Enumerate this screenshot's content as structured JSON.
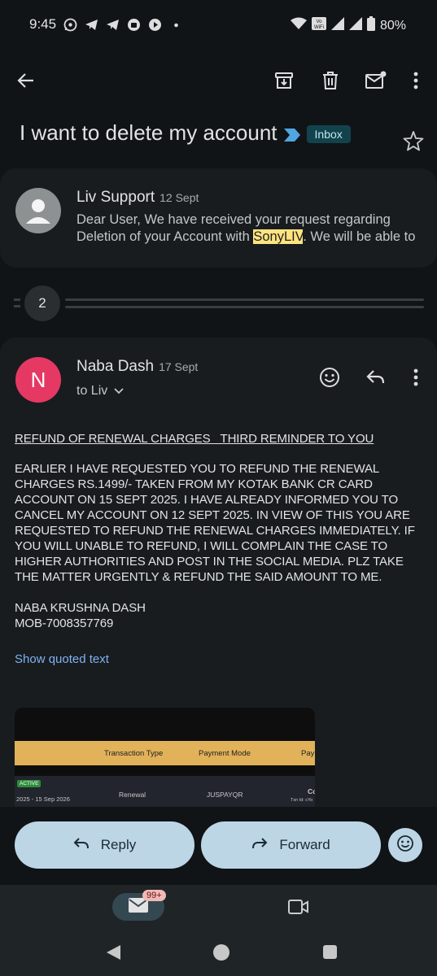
{
  "status_bar": {
    "time": "9:45",
    "battery": "80%",
    "wifi_label": "Vo WiFi"
  },
  "toolbar": {
    "icons": [
      "back-arrow-icon",
      "archive-icon",
      "delete-icon",
      "mark-unread-icon",
      "more-vert-icon"
    ]
  },
  "subject": {
    "title": "I want to delete my account",
    "label": "Inbox"
  },
  "message1": {
    "sender": "Liv Support",
    "date": "12 Sept",
    "snippet_line1": "Dear User, We have received your request regarding",
    "snippet_before": "Deletion of your Account with ",
    "snippet_highlight": "SonyLIV",
    "snippet_after": ". We will be able to"
  },
  "collapsed": {
    "count": "2"
  },
  "message2": {
    "avatar_letter": "N",
    "sender": "Naba Dash",
    "date": "17 Sept",
    "to": "to Liv",
    "heading": "REFUND OF RENEWAL CHARGES   THIRD REMINDER TO YOU",
    "paragraph": "EARLIER I HAVE REQUESTED YOU TO REFUND THE RENEWAL CHARGES RS.1499/- TAKEN FROM MY KOTAK BANK CR CARD ACCOUNT ON 15 SEPT 2025. I HAVE ALREADY INFORMED YOU TO CANCEL MY ACCOUNT ON 12 SEPT 2025. IN VIEW OF THIS YOU ARE REQUESTED TO REFUND THE RENEWAL CHARGES IMMEDIATELY. IF YOU WILL UNABLE TO  REFUND, I WILL COMPLAIN THE CASE TO HIGHER AUTHORITIES AND POST IN THE SOCIAL MEDIA. PLZ TAKE THE MATTER URGENTLY & REFUND THE SAID AMOUNT TO ME.",
    "signature_name": "NABA KRUSHNA DASH",
    "signature_mob": "MOB-7008357769",
    "show_quoted": "Show quoted text"
  },
  "embedded_table": {
    "headers": [
      "Transaction Type",
      "Payment Mode",
      "Paym"
    ],
    "status_tag": "ACTIVE",
    "period": "2025 - 15 Sep 2026",
    "type": "Renewal",
    "mode": "JUSPAYQR",
    "partial_col": "Co",
    "partial_sub": "Txn Id: cYo"
  },
  "actions": {
    "reply": "Reply",
    "forward": "Forward"
  },
  "bottom_nav": {
    "badge": "99+"
  },
  "colors": {
    "background": "#101417",
    "card": "#181c1f",
    "accent_button": "#bdd6e6",
    "avatar_n": "#e53964",
    "link": "#7fb2f0"
  }
}
